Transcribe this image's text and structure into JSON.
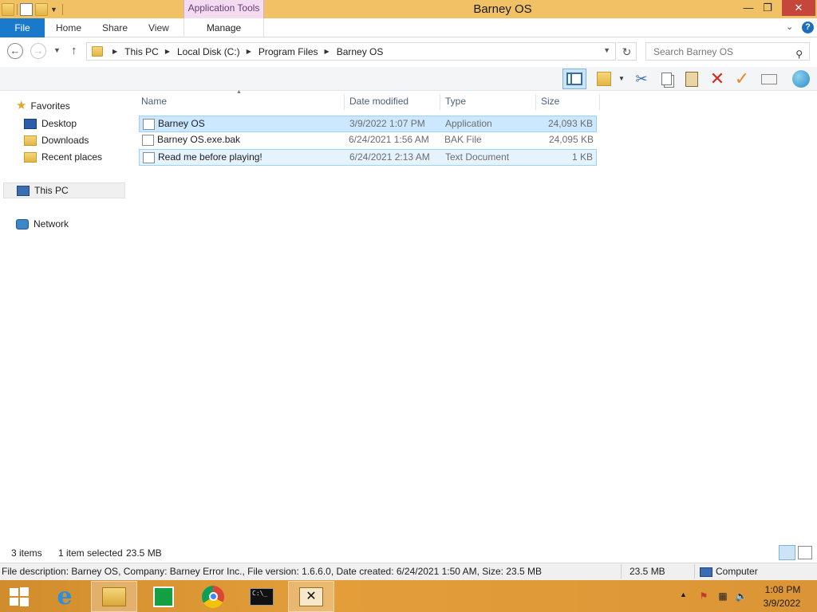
{
  "window": {
    "title": "Barney OS",
    "context_tab_group": "Application Tools",
    "controls": {
      "minimize": "—",
      "maximize": "❐",
      "close": "✕"
    }
  },
  "ribbon": {
    "tabs": [
      "File",
      "Home",
      "Share",
      "View",
      "Manage"
    ],
    "help": "?"
  },
  "navigation": {
    "back": "←",
    "forward": "→",
    "up": "↑",
    "breadcrumb": [
      "This PC",
      "Local Disk (C:)",
      "Program Files",
      "Barney OS"
    ],
    "search_placeholder": "Search Barney OS"
  },
  "nav_pane": {
    "favorites_label": "Favorites",
    "favorites": [
      "Desktop",
      "Downloads",
      "Recent places"
    ],
    "this_pc": "This PC",
    "network": "Network"
  },
  "columns": {
    "name": "Name",
    "date": "Date modified",
    "type": "Type",
    "size": "Size"
  },
  "files": [
    {
      "name": "Barney OS",
      "date": "3/9/2022 1:07 PM",
      "type": "Application",
      "size": "24,093 KB",
      "state": "selected",
      "icon": "application-icon"
    },
    {
      "name": "Barney OS.exe.bak",
      "date": "6/24/2021 1:56 AM",
      "type": "BAK File",
      "size": "24,095 KB",
      "state": "normal",
      "icon": "file-icon"
    },
    {
      "name": "Read me before playing!",
      "date": "6/24/2021 2:13 AM",
      "type": "Text Document",
      "size": "1 KB",
      "state": "hover",
      "icon": "text-document-icon"
    }
  ],
  "status": {
    "item_count": "3 items",
    "selection": "1 item selected",
    "selection_size": "23.5 MB"
  },
  "info_bar": {
    "description": "File description: Barney OS, Company: Barney Error Inc., File version: 1.6.6.0, Date created: 6/24/2021 1:50 AM, Size: 23.5 MB",
    "size": "23.5 MB",
    "location": "Computer"
  },
  "taskbar": {
    "apps": [
      "start-button",
      "internet-explorer",
      "file-explorer",
      "store",
      "chrome",
      "command-prompt",
      "hex-editor"
    ],
    "clock_time": "1:08 PM",
    "clock_date": "3/9/2022"
  },
  "colors": {
    "title_bar": "#f1c165",
    "file_tab": "#1979ca",
    "selection": "#cce8ff",
    "taskbar": "#e39e3a"
  }
}
